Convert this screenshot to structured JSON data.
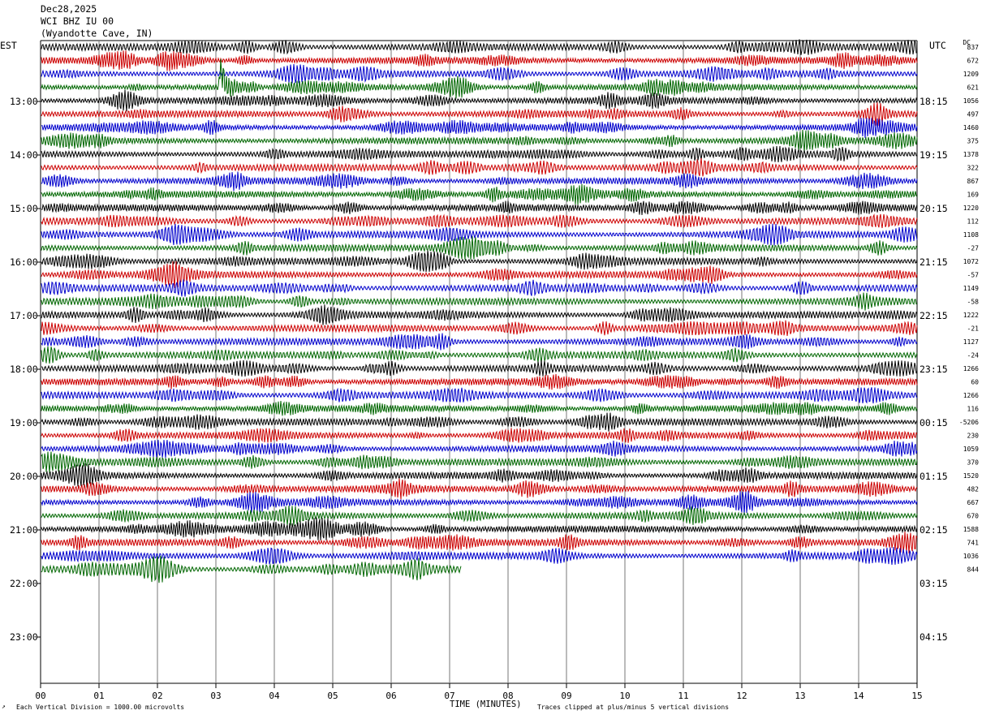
{
  "header": {
    "date": "Dec28,2025",
    "station": "WCI BHZ IU 00",
    "location": "(Wyandotte Cave, IN)"
  },
  "axis_labels": {
    "left_timezone": "EST",
    "right_timezone": "UTC",
    "dc_label": "DC",
    "xlabel": "TIME (MINUTES)"
  },
  "footer": {
    "scale_note": "Each Vertical Division = 1000.00 microvolts",
    "clip_note": "Traces clipped at plus/minus 5 vertical divisions"
  },
  "chart_data": {
    "type": "seismogram-helicorder",
    "x_range_minutes": [
      0,
      15
    ],
    "x_ticks": [
      "00",
      "01",
      "02",
      "03",
      "04",
      "05",
      "06",
      "07",
      "08",
      "09",
      "10",
      "11",
      "12",
      "13",
      "14",
      "15"
    ],
    "left_hour_labels": [
      "13:00",
      "14:00",
      "15:00",
      "16:00",
      "17:00",
      "18:00",
      "19:00",
      "20:00",
      "21:00",
      "22:00",
      "23:00"
    ],
    "right_hour_labels": [
      "18:15",
      "19:15",
      "20:15",
      "21:15",
      "22:15",
      "23:15",
      "00:15",
      "01:15",
      "02:15",
      "03:15",
      "04:15"
    ],
    "trace_colors": [
      "#000000",
      "#cc0000",
      "#0000cc",
      "#006600"
    ],
    "traces_per_hour": 4,
    "first_trace_offset_quarters": 3,
    "trace_count": 40,
    "last_trace_end_minute": 7.2,
    "dc_offsets": [
      "837",
      "672",
      "1209",
      "621",
      "1056",
      "497",
      "1460",
      "375",
      "1378",
      "322",
      "867",
      "169",
      "1220",
      "112",
      "1108",
      "-27",
      "1072",
      "-57",
      "1149",
      "-58",
      "1222",
      "-21",
      "1127",
      "-24",
      "1266",
      "60",
      "1266",
      "116",
      "-5206",
      "230",
      "1059",
      "370",
      "1520",
      "482",
      "667",
      "670",
      "1588",
      "741",
      "1036",
      "844"
    ],
    "gridline_color": "#777777"
  }
}
